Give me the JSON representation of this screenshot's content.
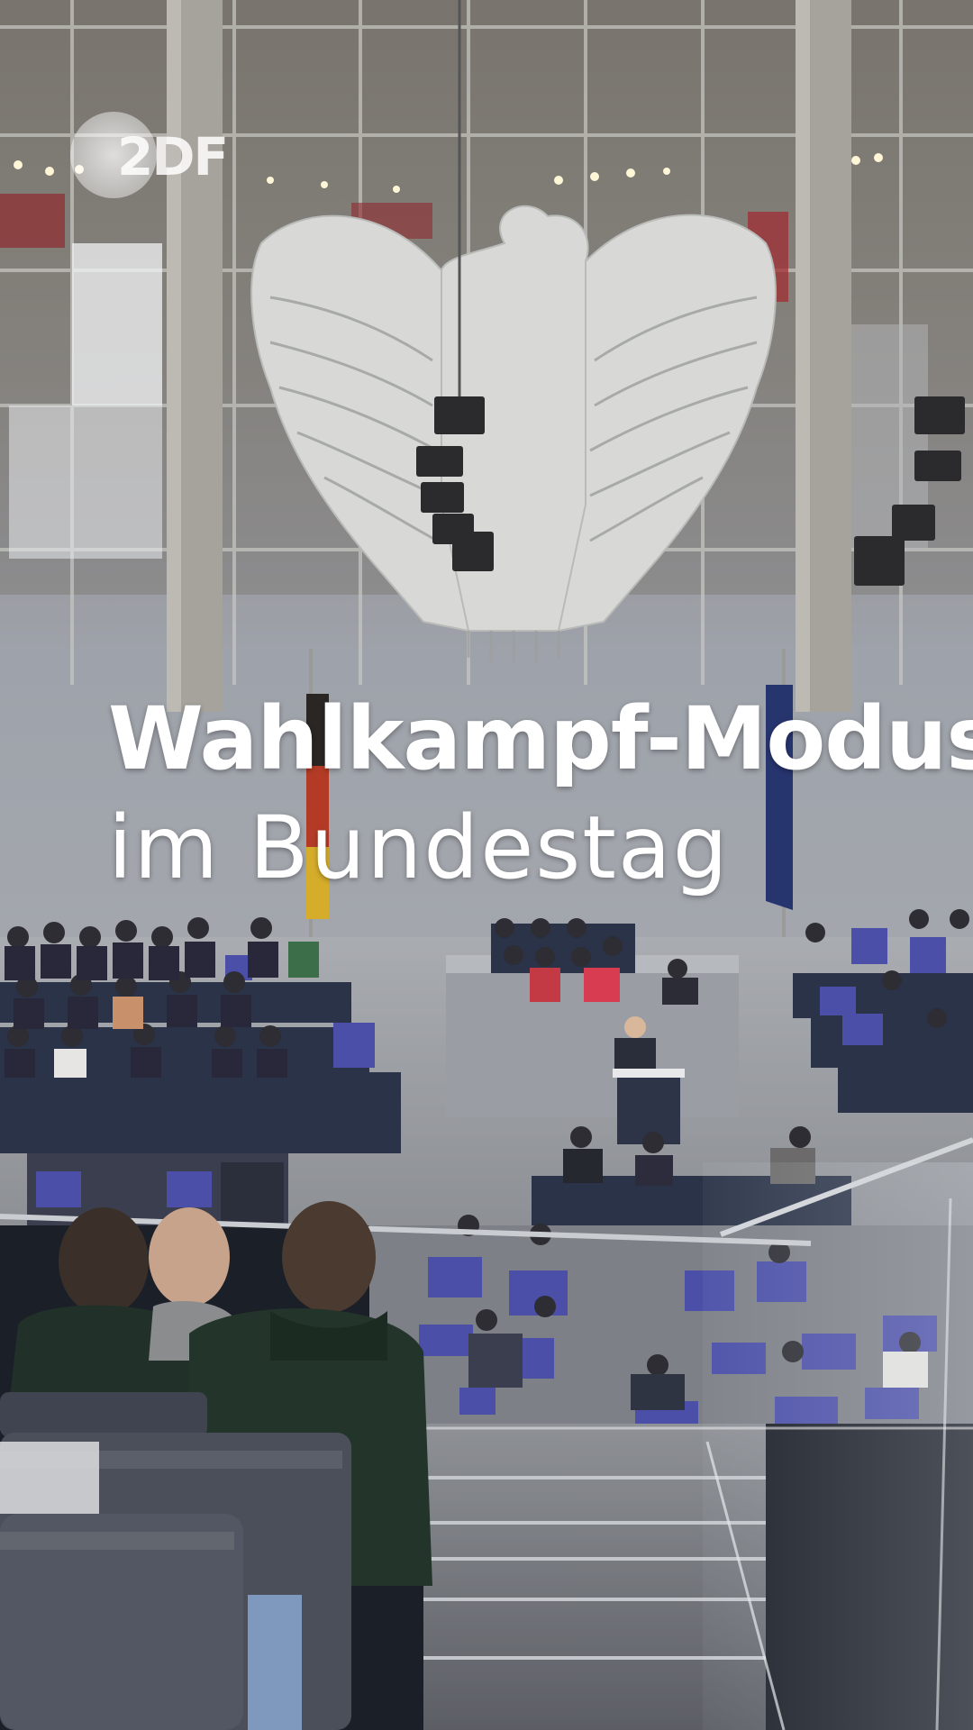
{
  "video": {
    "broadcaster_logo": {
      "text": "2DF",
      "icon": "zdf-logo-icon"
    },
    "headline": {
      "line1": "Wahlkampf-Modus",
      "line2": "im Bundestag"
    }
  },
  "colors": {
    "headline_text": "#ffffff",
    "seat_blue": "#4b4fa8",
    "floor_grey": "#8e9196"
  }
}
